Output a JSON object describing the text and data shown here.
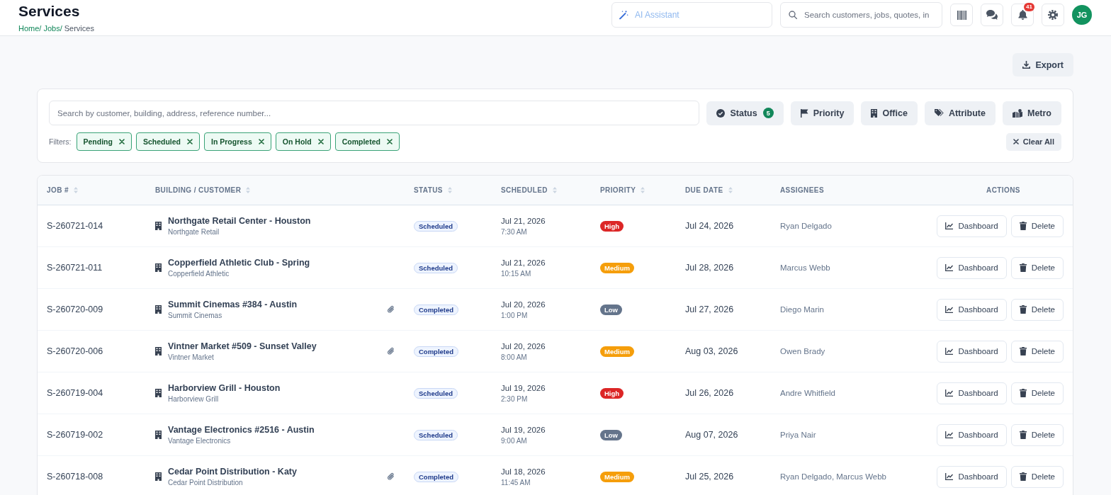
{
  "header": {
    "title": "Services",
    "breadcrumb": [
      {
        "label": "Home",
        "link": true,
        "separator": "/"
      },
      {
        "label": "Jobs",
        "link": true,
        "separator": "/"
      },
      {
        "label": "Services",
        "link": false
      }
    ],
    "ai_assistant": {
      "placeholder": "AI Assistant"
    },
    "search": {
      "placeholder": "Search customers, jobs, quotes, in"
    },
    "tools": [
      {
        "kind": "barcode"
      },
      {
        "kind": "chat"
      },
      {
        "kind": "notifications",
        "badge": "41"
      },
      {
        "kind": "settings"
      }
    ],
    "avatar": {
      "initials": "JG"
    }
  },
  "toolbar": {
    "export": "Export"
  },
  "filters": {
    "search": {
      "placeholder": "Search by customer, building, address, reference number..."
    },
    "buttons": [
      {
        "kind": "status",
        "label": "Status",
        "count": "5"
      },
      {
        "kind": "priority",
        "label": "Priority"
      },
      {
        "kind": "office",
        "label": "Office"
      },
      {
        "kind": "attribute",
        "label": "Attribute"
      },
      {
        "kind": "metro",
        "label": "Metro"
      }
    ],
    "label": "Filters:",
    "chips": [
      {
        "label": "Pending"
      },
      {
        "label": "Scheduled"
      },
      {
        "label": "In Progress"
      },
      {
        "label": "On Hold"
      },
      {
        "label": "Completed"
      }
    ],
    "clear": "Clear All"
  },
  "table": {
    "columns": [
      {
        "label": "JOB #",
        "sortable": true
      },
      {
        "label": "BUILDING / CUSTOMER",
        "sortable": true
      },
      {
        "label": "STATUS",
        "sortable": true
      },
      {
        "label": "SCHEDULED",
        "sortable": true
      },
      {
        "label": "PRIORITY",
        "sortable": true
      },
      {
        "label": "DUE DATE",
        "sortable": true
      },
      {
        "label": "ASSIGNEES",
        "sortable": false
      },
      {
        "label": "ACTIONS",
        "sortable": false
      }
    ],
    "rows": [
      {
        "job": "S-260721-014",
        "building": "Northgate Retail Center - Houston",
        "customer": "Northgate Retail",
        "attachment": false,
        "status": "Scheduled",
        "date": "Jul 21, 2026",
        "time": "7:30 AM",
        "priority": {
          "label": "High",
          "color": "#dc2626"
        },
        "due": "Jul 24, 2026",
        "assignees": "Ryan Delgado",
        "actions": [
          {
            "kind": "dashboard",
            "label": "Dashboard"
          },
          {
            "kind": "delete",
            "label": "Delete"
          }
        ]
      },
      {
        "job": "S-260721-011",
        "building": "Copperfield Athletic Club - Spring",
        "customer": "Copperfield Athletic",
        "attachment": false,
        "status": "Scheduled",
        "date": "Jul 21, 2026",
        "time": "10:15 AM",
        "priority": {
          "label": "Medium",
          "color": "#f59e0b"
        },
        "due": "Jul 28, 2026",
        "assignees": "Marcus Webb",
        "actions": [
          {
            "kind": "dashboard",
            "label": "Dashboard"
          },
          {
            "kind": "delete",
            "label": "Delete"
          }
        ]
      },
      {
        "job": "S-260720-009",
        "building": "Summit Cinemas #384 - Austin",
        "customer": "Summit Cinemas",
        "attachment": true,
        "status": "Completed",
        "date": "Jul 20, 2026",
        "time": "1:00 PM",
        "priority": {
          "label": "Low",
          "color": "#64748b"
        },
        "due": "Jul 27, 2026",
        "assignees": "Diego Marin",
        "actions": [
          {
            "kind": "dashboard",
            "label": "Dashboard"
          },
          {
            "kind": "delete",
            "label": "Delete"
          }
        ]
      },
      {
        "job": "S-260720-006",
        "building": "Vintner Market #509 - Sunset Valley",
        "customer": "Vintner Market",
        "attachment": true,
        "status": "Completed",
        "date": "Jul 20, 2026",
        "time": "8:00 AM",
        "priority": {
          "label": "Medium",
          "color": "#f59e0b"
        },
        "due": "Aug 03, 2026",
        "assignees": "Owen Brady",
        "actions": [
          {
            "kind": "dashboard",
            "label": "Dashboard"
          },
          {
            "kind": "delete",
            "label": "Delete"
          }
        ]
      },
      {
        "job": "S-260719-004",
        "building": "Harborview Grill - Houston",
        "customer": "Harborview Grill",
        "attachment": false,
        "status": "Scheduled",
        "date": "Jul 19, 2026",
        "time": "2:30 PM",
        "priority": {
          "label": "High",
          "color": "#dc2626"
        },
        "due": "Jul 26, 2026",
        "assignees": "Andre Whitfield",
        "actions": [
          {
            "kind": "dashboard",
            "label": "Dashboard"
          },
          {
            "kind": "delete",
            "label": "Delete"
          }
        ]
      },
      {
        "job": "S-260719-002",
        "building": "Vantage Electronics #2516 - Austin",
        "customer": "Vantage Electronics",
        "attachment": false,
        "status": "Scheduled",
        "date": "Jul 19, 2026",
        "time": "9:00 AM",
        "priority": {
          "label": "Low",
          "color": "#64748b"
        },
        "due": "Aug 07, 2026",
        "assignees": "Priya Nair",
        "actions": [
          {
            "kind": "dashboard",
            "label": "Dashboard"
          },
          {
            "kind": "delete",
            "label": "Delete"
          }
        ]
      },
      {
        "job": "S-260718-008",
        "building": "Cedar Point Distribution - Katy",
        "customer": "Cedar Point Distribution",
        "attachment": true,
        "status": "Completed",
        "date": "Jul 18, 2026",
        "time": "11:45 AM",
        "priority": {
          "label": "Medium",
          "color": "#f59e0b"
        },
        "due": "Jul 25, 2026",
        "assignees": "Ryan Delgado, Marcus Webb",
        "actions": [
          {
            "kind": "dashboard",
            "label": "Dashboard"
          },
          {
            "kind": "delete",
            "label": "Delete"
          }
        ]
      }
    ]
  }
}
